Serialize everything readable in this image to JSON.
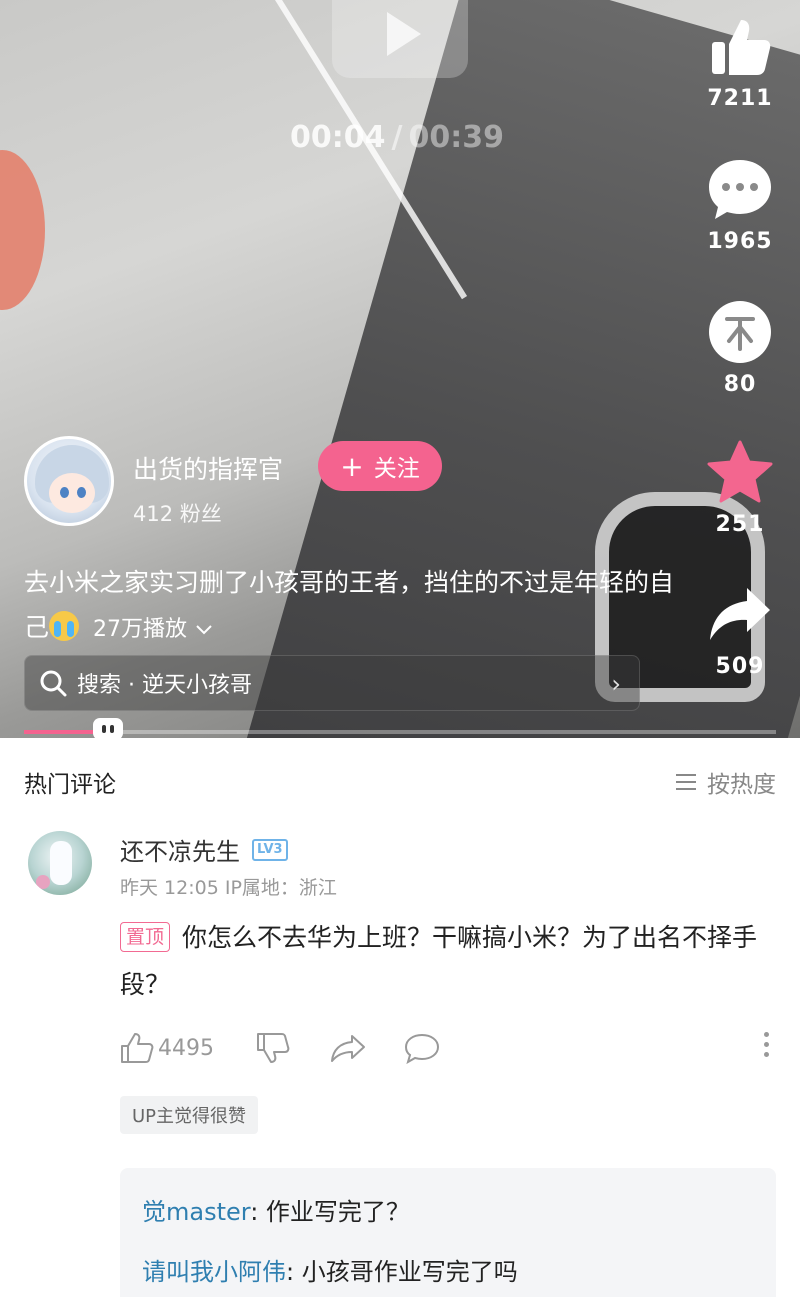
{
  "video": {
    "time_current": "00:04",
    "time_sep": "/",
    "time_total": "00:39",
    "progress": 0.1
  },
  "actions": {
    "like_count": "7211",
    "comment_count": "1965",
    "coin_count": "80",
    "favorite_count": "251",
    "share_count": "509"
  },
  "uploader": {
    "name": "出货的指挥官",
    "fans": "412 粉丝",
    "follow_label": "关注"
  },
  "description": {
    "text": "去小米之家实习删了小孩哥的王者，挡住的不过是年轻的自己",
    "plays": "27万播放"
  },
  "search": {
    "label": "搜索 · 逆天小孩哥"
  },
  "comments": {
    "title": "热门评论",
    "sort_label": "按热度",
    "top": {
      "user": "还不凉先生",
      "level": "LV3",
      "meta": "昨天 12:05  IP属地：浙江",
      "pin_label": "置顶",
      "text": "你怎么不去华为上班？干嘛搞小米？为了出名不择手段？",
      "likes": "4495",
      "up_badge": "UP主觉得很赞",
      "replies": [
        {
          "user": "觉master",
          "text": ": 作业写完了？"
        },
        {
          "user": "请叫我小阿伟",
          "text": ": 小孩哥作业写完了吗"
        }
      ]
    }
  },
  "colors": {
    "accent": "#f4638f",
    "reply_user": "#2f7fb0",
    "level_badge": "#6fb3e8"
  }
}
